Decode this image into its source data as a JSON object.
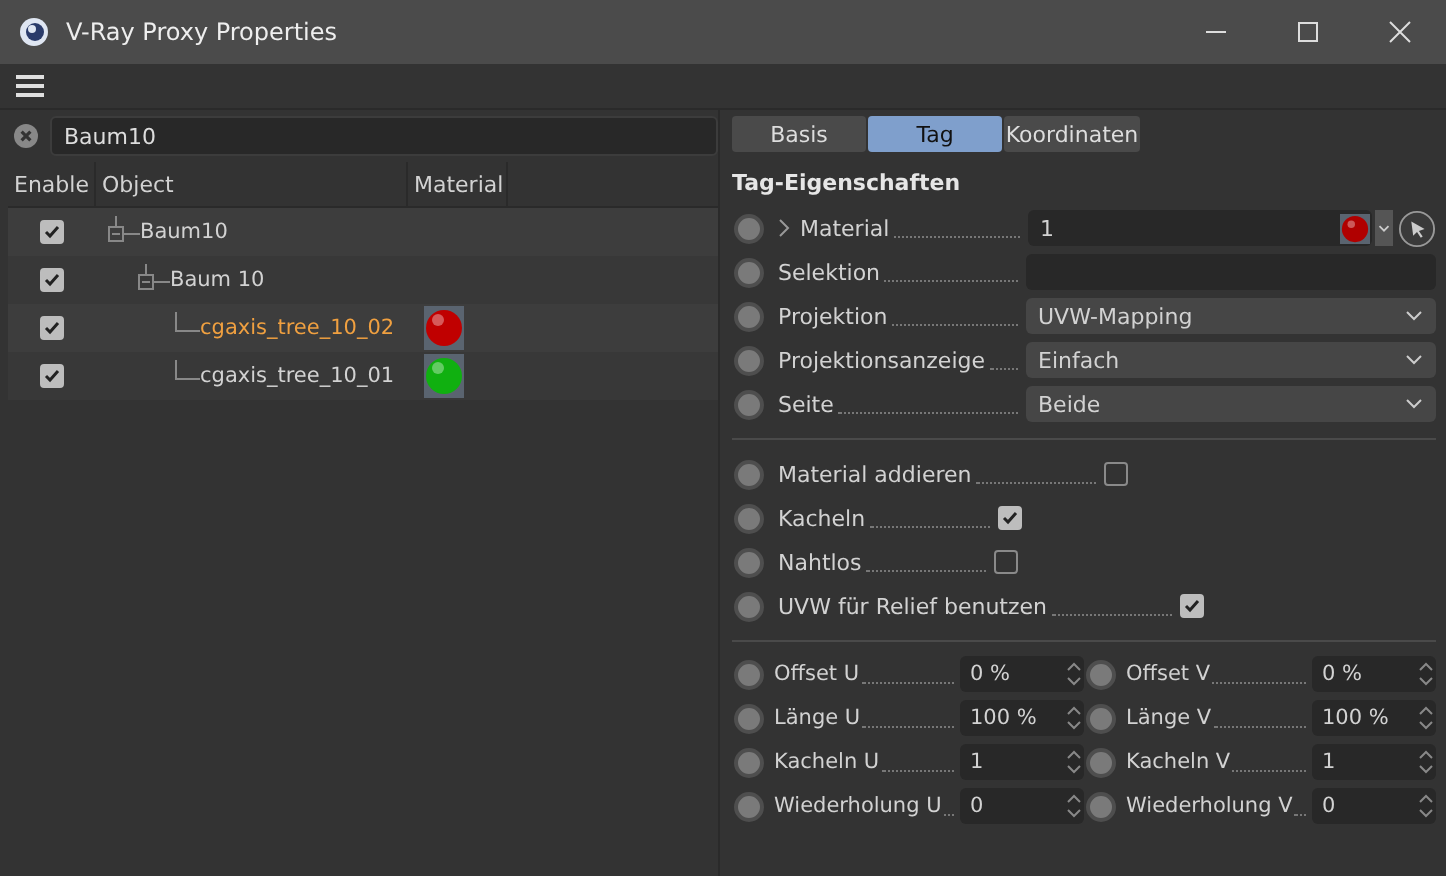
{
  "window": {
    "title": "V-Ray Proxy Properties"
  },
  "search": {
    "value": "Baum10"
  },
  "tree": {
    "columns": [
      "Enable",
      "Object",
      "Material"
    ],
    "items": [
      {
        "label": "Baum10",
        "enabled": true,
        "selected": false,
        "children": [
          {
            "label": "Baum 10",
            "enabled": true,
            "selected": false,
            "children": [
              {
                "label": "cgaxis_tree_10_02",
                "enabled": true,
                "selected": true,
                "color": "#c00000"
              },
              {
                "label": "cgaxis_tree_10_01",
                "enabled": true,
                "selected": false,
                "color": "#10b010"
              }
            ]
          }
        ]
      }
    ]
  },
  "tabs": [
    {
      "label": "Basis",
      "selected": false
    },
    {
      "label": "Tag",
      "selected": true
    },
    {
      "label": "Koordinaten",
      "selected": false
    }
  ],
  "section_title": "Tag-Eigenschaften",
  "properties": [
    {
      "kind": "link",
      "label": "Material",
      "value": "1"
    },
    {
      "kind": "text",
      "label": "Selektion"
    },
    {
      "kind": "dropdown",
      "label": "Projektion",
      "value": "UVW-Mapping"
    },
    {
      "kind": "dropdown",
      "label": "Projektionsanzeige",
      "value": "Einfach"
    },
    {
      "kind": "dropdown",
      "label": "Seite",
      "value": "Beide"
    }
  ],
  "options": [
    {
      "label": "Material addieren",
      "checked": false
    },
    {
      "label": "Kacheln",
      "checked": true
    },
    {
      "label": "Nahtlos",
      "checked": false
    },
    {
      "label": "UVW für Relief benutzen",
      "checked": true
    }
  ],
  "numbers": [
    {
      "label": "Offset U",
      "value": "0 %"
    },
    {
      "label": "Offset V",
      "value": "0 %"
    },
    {
      "label": "Länge U",
      "value": "100 %"
    },
    {
      "label": "Länge V",
      "value": "100 %"
    },
    {
      "label": "Kacheln U",
      "value": "1"
    },
    {
      "label": "Kacheln V",
      "value": "1"
    },
    {
      "label": "Wiederholung U",
      "value": "0"
    },
    {
      "label": "Wiederholung V",
      "value": "0"
    }
  ]
}
